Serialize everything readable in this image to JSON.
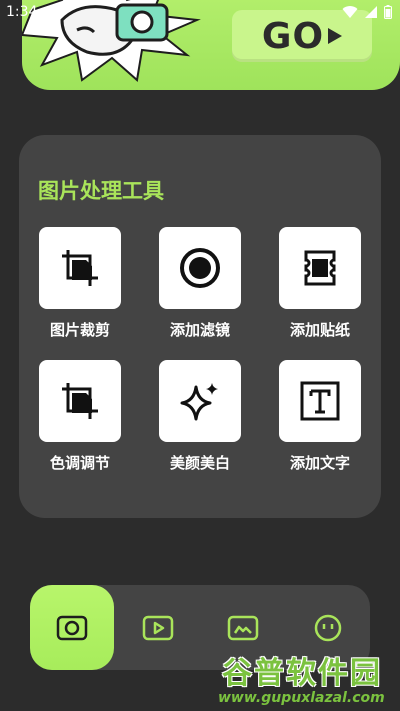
{
  "status_bar": {
    "time": "1:34"
  },
  "banner": {
    "go_label": "GO"
  },
  "tools": {
    "title": "图片处理工具",
    "items": [
      {
        "label": "图片裁剪",
        "icon": "crop-icon"
      },
      {
        "label": "添加滤镜",
        "icon": "filter-record-icon"
      },
      {
        "label": "添加贴纸",
        "icon": "sticker-ticket-icon"
      },
      {
        "label": "色调调节",
        "icon": "tone-crop-icon"
      },
      {
        "label": "美颜美白",
        "icon": "sparkle-icon"
      },
      {
        "label": "添加文字",
        "icon": "text-box-icon"
      }
    ]
  },
  "bottom_nav": {
    "items": [
      {
        "icon": "camera-icon",
        "active": true
      },
      {
        "icon": "video-play-icon",
        "active": false
      },
      {
        "icon": "gallery-icon",
        "active": false
      },
      {
        "icon": "smiley-profile-icon",
        "active": false
      }
    ]
  },
  "watermark": {
    "title": "谷普软件园",
    "url": "www.gupuxlazal.com"
  },
  "colors": {
    "accent": "#a9e45a",
    "card": "#444444",
    "background": "#2c2c2c"
  }
}
